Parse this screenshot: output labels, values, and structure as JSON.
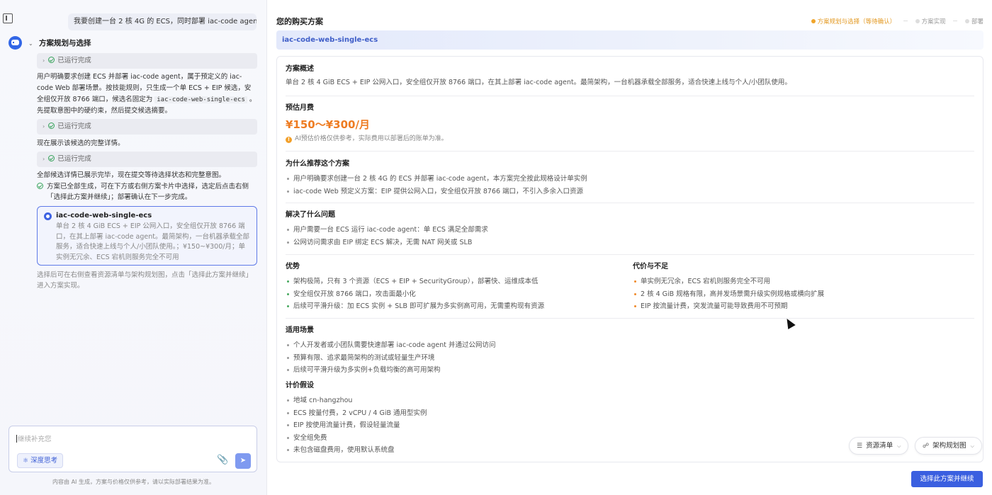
{
  "chat": {
    "user_message": "我要创建一台 2 核 4G 的 ECS，同时部署 iac-code agent。",
    "section_title": "方案规划与选择",
    "run_status": "已运行完成",
    "para1": "用户明确要求创建 ECS 并部署 iac-code agent，属于预定义的 iac-code Web 部署场景。按技能规则，只生成一个单 ECS + EIP 候选，安全组仅开放 8766 端口，候选名固定为",
    "para1_code": "iac-code-web-single-ecs",
    "para1_end": "。",
    "para1_line2": "先提取意图中的硬约束，然后提交候选摘要。",
    "para2": "现在展示该候选的完整详情。",
    "para3": "全部候选详情已展示完毕，现在提交等待选择状态和完整意图。",
    "done_line1": "方案已全部生成，可在下方或右侧方案卡片中选择，选定后点击右侧",
    "done_line2": "「选择此方案并继续」；部署确认在下一步完成。",
    "plan_card": {
      "name": "iac-code-web-single-ecs",
      "desc": "单台 2 核 4 GiB ECS + EIP 公网入口，安全组仅开放 8766 端口，在其上部署 iac-code agent。最简架构，一台机器承载全部服务，适合快速上线与个人/小团队使用。；¥150~¥300/月；单实例无冗余、ECS 宕机则服务完全不可用"
    },
    "hint": "选择后可在右侧查看资源清单与架构规划图，点击「选择此方案并继续」进入方案实现。",
    "input_placeholder": "继续补充您",
    "deep_think_label": "深度思考",
    "disclaimer": "内容由 AI 生成，方案与价格仅供参考，请以实际部署结果为准。"
  },
  "right": {
    "title": "您的购买方案",
    "steps": [
      {
        "label": "方案规划与选择（等待确认）",
        "active": true
      },
      {
        "label": "方案实现",
        "active": false
      },
      {
        "label": "部署",
        "active": false
      }
    ],
    "plan_name": "iac-code-web-single-ecs",
    "overview_title": "方案概述",
    "overview_text": "单台 2 核 4 GiB ECS + EIP 公网入口，安全组仅开放 8766 端口，在其上部署 iac-code agent。最简架构，一台机器承载全部服务，适合快速上线与个人/小团队使用。",
    "cost_title": "预估月费",
    "cost_value": "¥150～¥300/月",
    "cost_note": "AI预估价格仅供参考，实际费用以部署后的账单为准。",
    "why_title": "为什么推荐这个方案",
    "why_items": [
      "用户明确要求创建一台 2 核 4G 的 ECS 并部署 iac-code agent，本方案完全按此规格设计单实例",
      "iac-code Web 预定义方案：EIP 提供公网入口，安全组仅开放 8766 端口，不引入多余入口资源"
    ],
    "solve_title": "解决了什么问题",
    "solve_items": [
      "用户需要一台 ECS 运行 iac-code agent：单 ECS 满足全部需求",
      "公网访问需求由 EIP 绑定 ECS 解决，无需 NAT 网关或 SLB"
    ],
    "pros_title": "优势",
    "pros_items": [
      "架构极简，只有 3 个资源（ECS + EIP + SecurityGroup），部署快、运维成本低",
      "安全组仅开放 8766 端口，攻击面最小化",
      "后续可平滑升级：加 ECS 实例 + SLB 即可扩展为多实例高可用，无需重构现有资源"
    ],
    "cons_title": "代价与不足",
    "cons_items": [
      "单实例无冗余，ECS 宕机则服务完全不可用",
      "2 核 4 GiB 规格有限，高并发场景需升级实例规格或横向扩展",
      "EIP 按流量计费，突发流量可能导致费用不可预期"
    ],
    "scene_title": "适用场景",
    "scene_items": [
      "个人开发者或小团队需要快速部署 iac-code agent 并通过公网访问",
      "预算有限、追求最简架构的测试或轻量生产环境",
      "后续可平滑升级为多实例+负载均衡的高可用架构"
    ],
    "pricing_title": "计价假设",
    "pricing_items": [
      "地域 cn-hangzhou",
      "ECS 按量付费，2 vCPU / 4 GiB 通用型实例",
      "EIP 按使用流量计费，假设轻量流量",
      "安全组免费",
      "未包含磁盘费用，使用默认系统盘"
    ],
    "resource_list_label": "资源清单",
    "arch_label": "架构规划图",
    "primary_label": "选择此方案并继续"
  }
}
